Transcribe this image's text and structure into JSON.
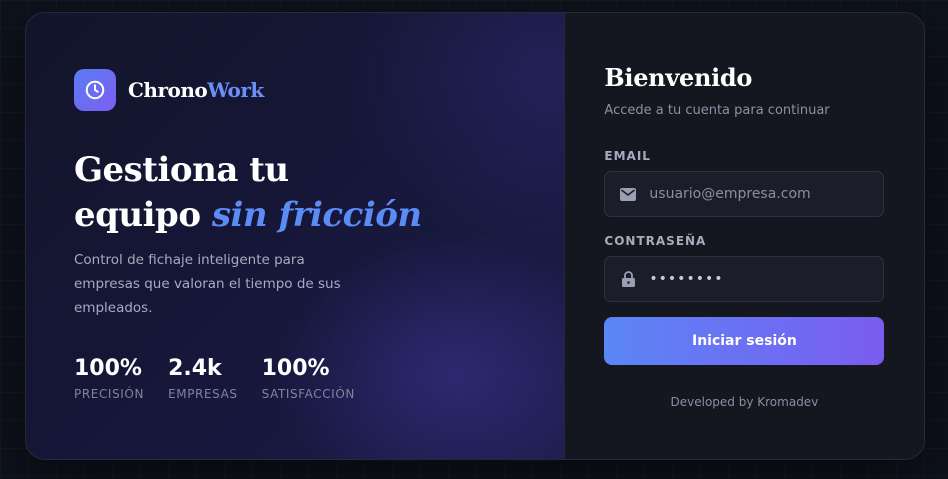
{
  "brand": {
    "name_primary": "Chrono",
    "name_accent": "Work",
    "logo_icon": "clock-icon",
    "accent_color": "#5b8bf5"
  },
  "hero": {
    "headline_line1": "Gestiona tu",
    "headline_line2_plain": "equipo ",
    "headline_line2_accent": "sin fricción",
    "description": "Control de fichaje inteligente para empresas que valoran el tiempo de sus empleados."
  },
  "stats": [
    {
      "value": "100%",
      "label": "PRECISIÓN"
    },
    {
      "value": "2.4k",
      "label": "EMPRESAS"
    },
    {
      "value": "100%",
      "label": "SATISFACCIÓN"
    }
  ],
  "login": {
    "title": "Bienvenido",
    "subtitle": "Accede a tu cuenta para continuar",
    "email_label": "EMAIL",
    "email_placeholder": "usuario@empresa.com",
    "email_icon": "mail-icon",
    "password_label": "CONTRASEÑA",
    "password_value": "••••••••",
    "password_icon": "lock-icon",
    "submit_label": "Iniciar sesión",
    "footer": "Developed by Kromadev",
    "button_gradient": [
      "#5b86f5",
      "#7a5cf0"
    ]
  }
}
